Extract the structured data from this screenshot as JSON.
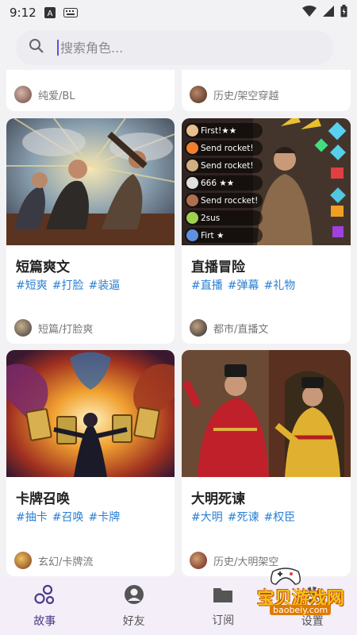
{
  "status_bar": {
    "time": "9:12"
  },
  "search": {
    "placeholder": "搜索角色..."
  },
  "top_partial": [
    {
      "category": "纯爱/BL"
    },
    {
      "category": "历史/架空穿越"
    }
  ],
  "cards": [
    {
      "title": "短篇爽文",
      "tags": [
        "#短爽",
        "#打脸",
        "#装逼"
      ],
      "category": "短篇/打脸爽"
    },
    {
      "title": "直播冒险",
      "tags": [
        "#直播",
        "#弹幕",
        "#礼物"
      ],
      "category": "都市/直播文",
      "overlay_comments": [
        "First!★★",
        "Send rocket!",
        "Send rocket!",
        "666 ★★",
        "Send roccket!",
        "2sus",
        "Firt ★"
      ]
    },
    {
      "title": "卡牌召唤",
      "tags": [
        "#抽卡",
        "#召唤",
        "#卡牌"
      ],
      "category": "玄幻/卡牌流"
    },
    {
      "title": "大明死谏",
      "tags": [
        "#大明",
        "#死谏",
        "#权臣"
      ],
      "category": "历史/大明架空"
    }
  ],
  "bottom_nav": [
    {
      "label": "故事",
      "icon": "bubbles-icon",
      "active": true
    },
    {
      "label": "好友",
      "icon": "person-icon",
      "active": false
    },
    {
      "label": "订阅",
      "icon": "folder-icon",
      "active": false
    },
    {
      "label": "设置",
      "icon": "gear-icon",
      "active": false
    }
  ],
  "watermark": {
    "text": "宝贝游戏网",
    "url": "baobeiy.com"
  },
  "colors": {
    "tag_blue": "#2a7fd4",
    "accent_purple": "#6b4bd8",
    "nav_bg": "#f3eef8"
  }
}
